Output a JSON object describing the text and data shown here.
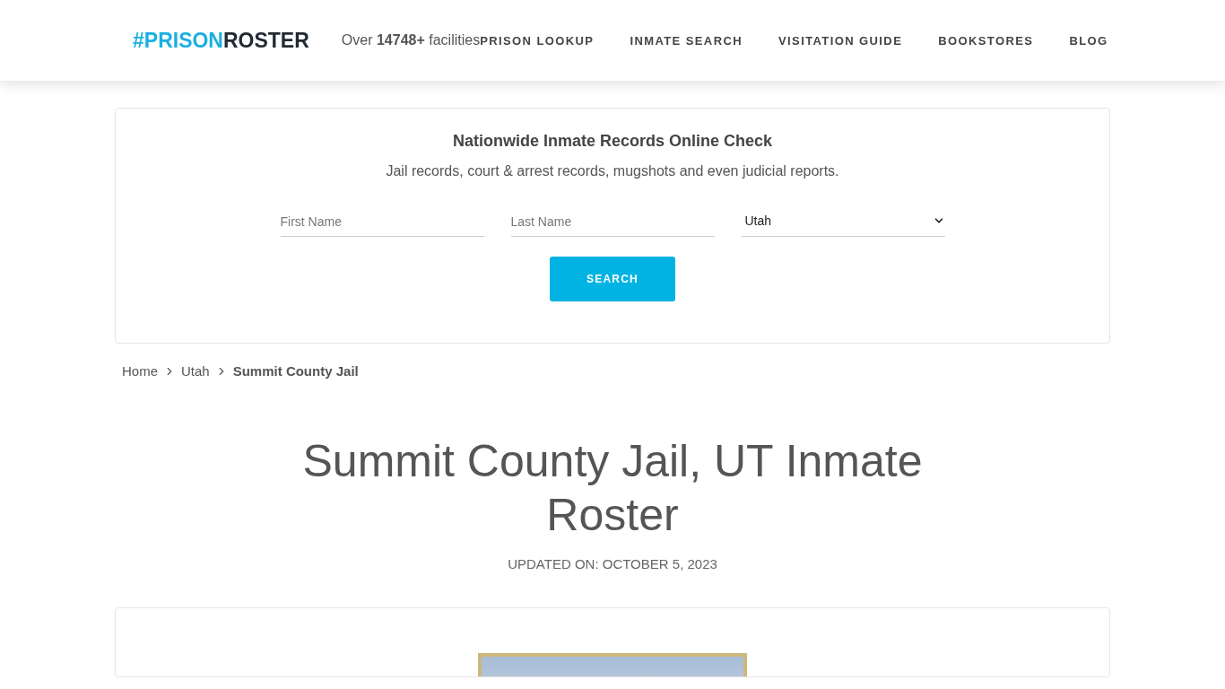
{
  "header": {
    "logo": {
      "primary": "#PRISON",
      "secondary": "ROSTER"
    },
    "facility_count": "Over **14748+** facilities",
    "nav": [
      "PRISON LOOKUP",
      "INMATE SEARCH",
      "VISITATION GUIDE",
      "BOOKSTORES",
      "BLOG"
    ]
  },
  "search_card": {
    "title": "Nationwide Inmate Records Online Check",
    "subtitle": "Jail records, court & arrest records, mugshots and even judicial reports.",
    "fields": [
      {
        "placeholder": "First Name"
      },
      {
        "placeholder": "Last Name"
      }
    ],
    "state_select": {
      "value": "Utah"
    },
    "button": "SEARCH"
  },
  "breadcrumb": [
    {
      "label": "Home",
      "current": false
    },
    {
      "label": "Utah",
      "current": false
    },
    {
      "label": "Summit County Jail",
      "current": true
    }
  ],
  "page_title": "Summit County Jail, UT Inmate Roster",
  "updated": "UPDATED ON: OCTOBER 5, 2023"
}
